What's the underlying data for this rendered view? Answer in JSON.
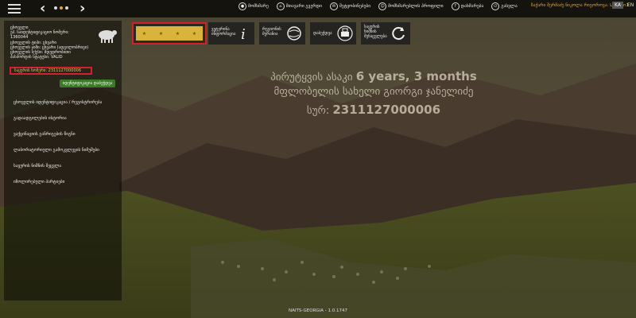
{
  "topbar": {
    "menu": [
      {
        "icon": "person-icon",
        "label": "მომხმარე"
      },
      {
        "icon": "home-icon",
        "label": "მთავარი გვერდი"
      },
      {
        "icon": "contact-icon",
        "label": "შეტყობინებები"
      },
      {
        "icon": "people-icon",
        "label": "მომხმარებლის პროფილი"
      },
      {
        "icon": "help-icon",
        "label": "დახმარება"
      },
      {
        "icon": "exit-icon",
        "label": "გასვლა"
      }
    ],
    "user": "ზაქარი შერმაძე ნიკოლა რიგოროვა: Ladmin1",
    "lang_ka": "KA",
    "lang_en": "EN"
  },
  "animal_info": {
    "line1": "ცხოველი",
    "line2": "ეპ. საიდენტიფიკაციო ნომერი:",
    "line3": "1360044",
    "line4": "ცხოველის ტიპი: ცხვარი",
    "line5": "ცხოველის ჯიში: ცხვარი (ადგილობრივი)",
    "line6": "ცხოველის სქესი: მდედრობითი",
    "line7": "პასპორტის სტატუსი: VALID",
    "highlight": "საყურის ნომერი: 2311127000006",
    "print_button": "იდენტიფიკაცია დაბეჭდვა"
  },
  "side_menu": [
    "ცხოველის იდენტიფიკაცია / რეგისტრირება",
    "გადაადგილების ისტორია",
    "ვაქცინაციის განრიგების წიგნი",
    "ლაბორატორიული გამოკვლევის ნიმუშები",
    "საყურის ნიშნის შეცვლა",
    "იზოლირებული პარტიები"
  ],
  "action_bar": {
    "btn1": "ვეტერინა ინფორმაცია",
    "btn2": "რეგიონის მერანია",
    "btn3": "დაბეჭდვა",
    "btn4": "საყურის ნიშნის შენაცვლება"
  },
  "center": {
    "age_prefix": "პირუტყვის ასაკი",
    "age_value": "6 years, 3 months",
    "owner_prefix": "მფლობელის სახელი",
    "owner_value": "გიორგი ჯანელიძე",
    "ear_prefix": "სურ:",
    "ear_value": "2311127000006"
  },
  "footer": "NAITS-GEORGIA - 1.0.1747",
  "colors": {
    "accent": "#e8a23a",
    "highlight_border": "#d3202a",
    "star_bg": "#d9b33a"
  }
}
